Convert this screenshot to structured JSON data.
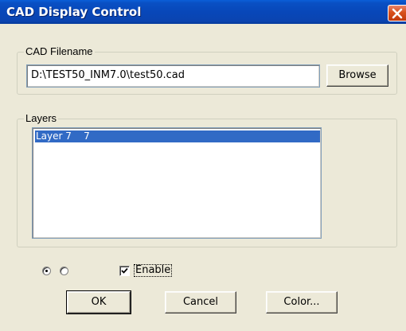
{
  "window": {
    "title": "CAD Display Control",
    "close_icon": "close-icon"
  },
  "filename_group": {
    "legend": "CAD  Filename",
    "path_value": "D:\\TEST50_INM7.0\\test50.cad",
    "browse_label": "Browse"
  },
  "layers_group": {
    "legend": "Layers",
    "items": [
      {
        "label": "Layer 7    7",
        "selected": true
      }
    ]
  },
  "options": {
    "radios": [
      {
        "name": "radio-1",
        "checked": true
      },
      {
        "name": "radio-2",
        "checked": false
      }
    ],
    "enable_label": "Enable",
    "enable_checked": true
  },
  "buttons": {
    "ok": "OK",
    "cancel": "Cancel",
    "color": "Color..."
  },
  "colors": {
    "titlebar": "#0847b9",
    "dialog_bg": "#ece9d8",
    "selection": "#316ac5",
    "close_button": "#d8501c"
  }
}
